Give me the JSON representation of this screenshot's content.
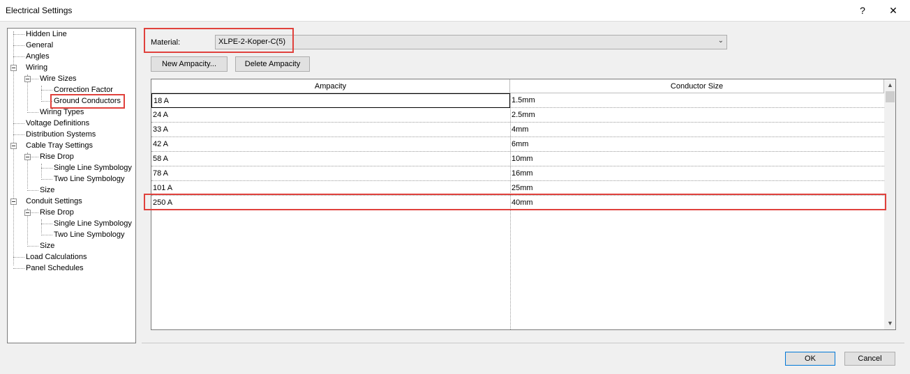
{
  "window": {
    "title": "Electrical Settings",
    "help_label": "?",
    "close_label": "✕"
  },
  "tree": {
    "items": [
      {
        "label": "Hidden Line"
      },
      {
        "label": "General"
      },
      {
        "label": "Angles"
      },
      {
        "label": "Wiring"
      },
      {
        "label": "Wire Sizes"
      },
      {
        "label": "Correction Factor"
      },
      {
        "label": "Ground Conductors"
      },
      {
        "label": "Wiring Types"
      },
      {
        "label": "Voltage Definitions"
      },
      {
        "label": "Distribution Systems"
      },
      {
        "label": "Cable Tray Settings"
      },
      {
        "label": "Rise Drop"
      },
      {
        "label": "Single Line Symbology"
      },
      {
        "label": "Two Line Symbology"
      },
      {
        "label": "Size"
      },
      {
        "label": "Conduit Settings"
      },
      {
        "label": "Rise Drop"
      },
      {
        "label": "Single Line Symbology"
      },
      {
        "label": "Two Line Symbology"
      },
      {
        "label": "Size"
      },
      {
        "label": "Load Calculations"
      },
      {
        "label": "Panel Schedules"
      }
    ]
  },
  "material": {
    "label": "Material:",
    "value": "XLPE-2-Koper-C(5)"
  },
  "buttons": {
    "new_ampacity": "New Ampacity...",
    "delete_ampacity": "Delete Ampacity",
    "ok": "OK",
    "cancel": "Cancel"
  },
  "table": {
    "columns": [
      "Ampacity",
      "Conductor Size"
    ],
    "rows": [
      {
        "ampacity": "18 A",
        "size": "1.5mm"
      },
      {
        "ampacity": "24 A",
        "size": "2.5mm"
      },
      {
        "ampacity": "33 A",
        "size": "4mm"
      },
      {
        "ampacity": "42 A",
        "size": "6mm"
      },
      {
        "ampacity": "58 A",
        "size": "10mm"
      },
      {
        "ampacity": "78 A",
        "size": "16mm"
      },
      {
        "ampacity": "101 A",
        "size": "25mm"
      },
      {
        "ampacity": "250 A",
        "size": "40mm"
      }
    ]
  },
  "colors": {
    "highlight": "#e0413c",
    "ok_border": "#0078d7"
  }
}
